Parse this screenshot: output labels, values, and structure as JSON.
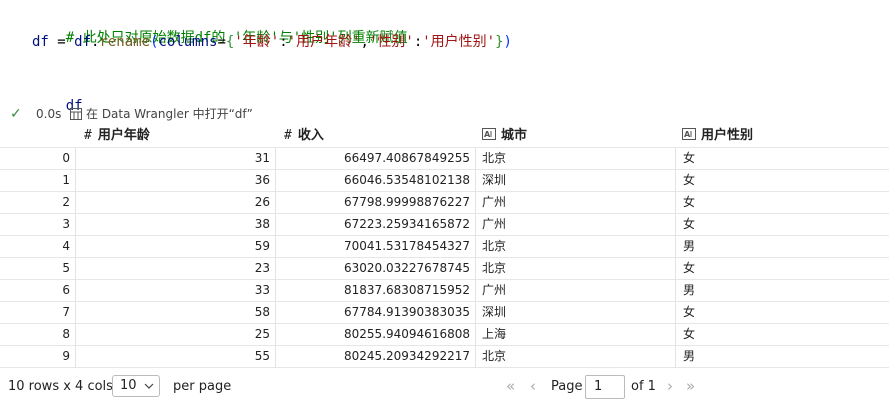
{
  "code": {
    "comment": "# 此处只对原始数据df的 '年龄'与'性别'列重新赋值",
    "line2": {
      "lhs": "df",
      "eq": " = ",
      "obj": "df",
      "dot": ".",
      "method": "rename",
      "paren_open": "(",
      "kwarg": "columns",
      "eq2": "=",
      "brace_open": "{",
      "k1": "'年龄'",
      "colon1": ":",
      "v1": "'用户年龄'",
      "comma": ",",
      "k2": "'性别'",
      "colon2": ":",
      "v2": "'用户性别'",
      "brace_close": "}",
      "paren_close": ")"
    },
    "line4": "df"
  },
  "status": {
    "check": "✓",
    "time": "0.0s",
    "data_wrangler": "在 Data Wrangler 中打开“df”"
  },
  "table": {
    "columns": [
      {
        "name": "用户年龄",
        "type": "numeric",
        "type_glyph": "#"
      },
      {
        "name": "收入",
        "type": "numeric",
        "type_glyph": "#"
      },
      {
        "name": "城市",
        "type": "text"
      },
      {
        "name": "用户性别",
        "type": "text"
      }
    ],
    "rows": [
      {
        "idx": "0",
        "age": "31",
        "income": "66497.40867849255",
        "city": "北京",
        "gender": "女"
      },
      {
        "idx": "1",
        "age": "36",
        "income": "66046.53548102138",
        "city": "深圳",
        "gender": "女"
      },
      {
        "idx": "2",
        "age": "26",
        "income": "67798.99998876227",
        "city": "广州",
        "gender": "女"
      },
      {
        "idx": "3",
        "age": "38",
        "income": "67223.25934165872",
        "city": "广州",
        "gender": "女"
      },
      {
        "idx": "4",
        "age": "59",
        "income": "70041.53178454327",
        "city": "北京",
        "gender": "男"
      },
      {
        "idx": "5",
        "age": "23",
        "income": "63020.03227678745",
        "city": "北京",
        "gender": "女"
      },
      {
        "idx": "6",
        "age": "33",
        "income": "81837.68308715952",
        "city": "广州",
        "gender": "男"
      },
      {
        "idx": "7",
        "age": "58",
        "income": "67784.91390383035",
        "city": "深圳",
        "gender": "女"
      },
      {
        "idx": "8",
        "age": "25",
        "income": "80255.94094616808",
        "city": "上海",
        "gender": "女"
      },
      {
        "idx": "9",
        "age": "55",
        "income": "80245.20934292217",
        "city": "北京",
        "gender": "男"
      }
    ]
  },
  "pager": {
    "summary": "10 rows x 4 cols",
    "page_size": "10",
    "per_page": "per page",
    "first": "«",
    "prev": "‹",
    "page_label": "Page",
    "page_value": "1",
    "of_label": "of 1",
    "next": "›",
    "last": "»"
  },
  "colors": {
    "comment": "#008000",
    "string": "#a31515",
    "success": "#388a34"
  }
}
